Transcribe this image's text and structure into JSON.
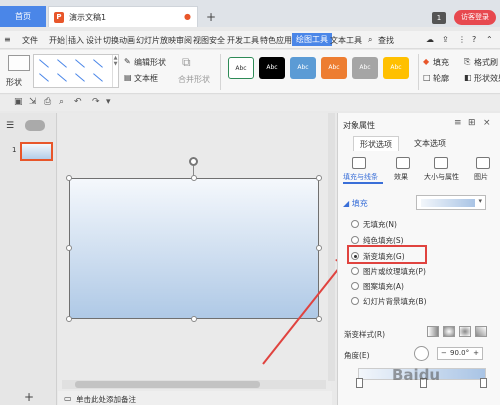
{
  "tabs": {
    "home": "首页",
    "document": "演示文稿1",
    "page_count": "1",
    "visitor": "访客登录"
  },
  "menu": {
    "items": [
      "文件",
      "开始",
      "插入",
      "设计",
      "切换",
      "动画",
      "幻灯片放映",
      "审阅",
      "视图",
      "安全",
      "开发工具",
      "特色应用",
      "绘图工具",
      "文本工具",
      "查找"
    ],
    "active": "绘图工具"
  },
  "ribbon": {
    "shape_label": "形状",
    "edit_shape": "编辑形状",
    "text_box": "文本框",
    "merge_shape": "合并形状",
    "style_text": "Abc",
    "fill": "填充",
    "outline": "轮廓",
    "format_brush": "格式刷",
    "shape_effect": "形状效果"
  },
  "style_colors": [
    "#ffffff",
    "#000000",
    "#5b9bd5",
    "#ed7d31",
    "#a5a5a5",
    "#ffc000"
  ],
  "slides": {
    "current_number": "1"
  },
  "notes_placeholder": "单击此处添加备注",
  "panel": {
    "title": "对象属性",
    "tab_shape": "形状选项",
    "tab_text": "文本选项",
    "sub_fill_line": "填充与线条",
    "sub_effect": "效果",
    "sub_size": "大小与属性",
    "sub_picture": "图片",
    "fill_heading": "填充",
    "fill_options": [
      "无填充(N)",
      "纯色填充(S)",
      "渐变填充(G)",
      "图片或纹理填充(P)",
      "图案填充(A)",
      "幻灯片背景填充(B)"
    ],
    "selected_fill": "渐变填充(G)",
    "gradient_style_label": "渐变样式(R)",
    "angle_label": "角度(E)",
    "angle_value": "90.0°"
  },
  "watermark": "Baidu"
}
